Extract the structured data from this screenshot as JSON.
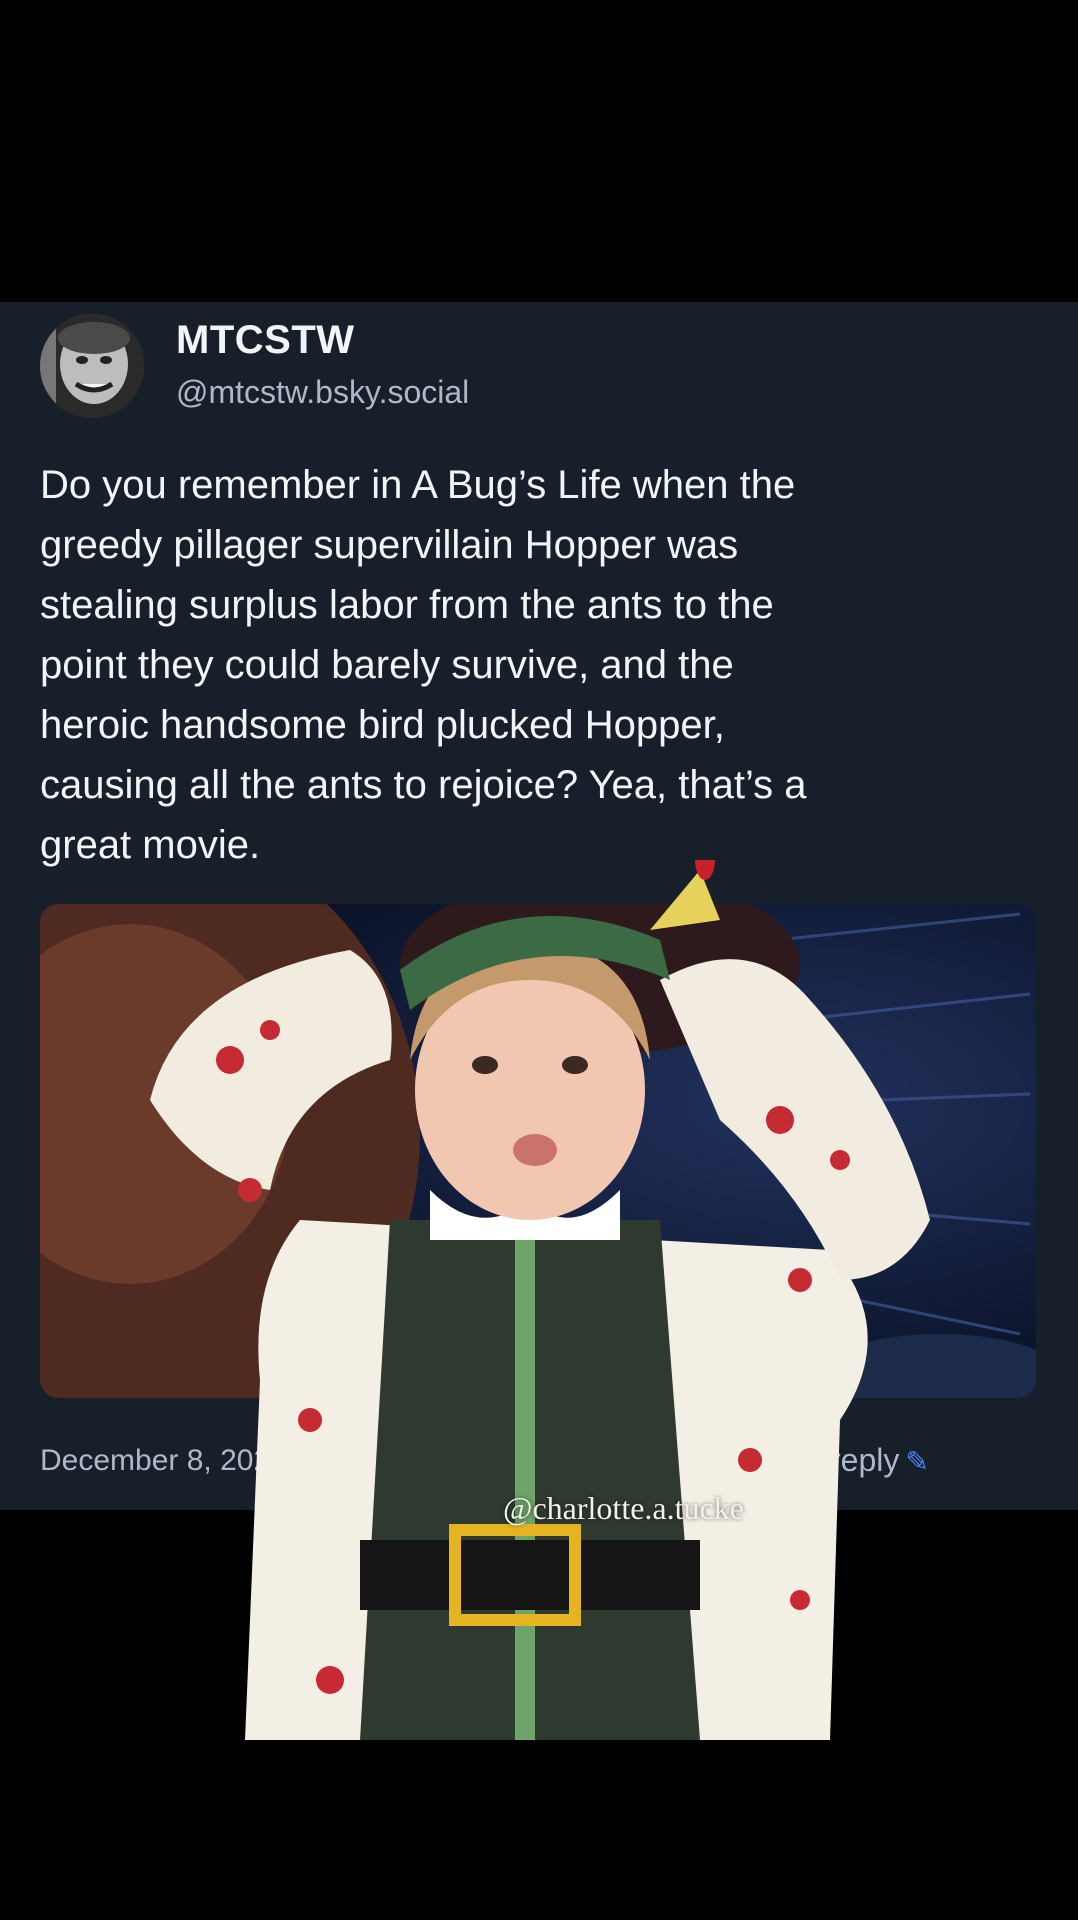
{
  "post": {
    "author": {
      "display_name": "MTCSTW",
      "handle": "@mtcstw.bsky.social"
    },
    "text_lines": [
      "Do you remember in A Bug’s Life when the",
      "greedy pillager supervillain Hopper was",
      "stealing surplus labor from the ants to the",
      "point they could barely survive, and the",
      "heroic handsome bird plucked Hopper,",
      "causing all the ants to rejoice? Yea, that’s a",
      "great movie."
    ],
    "date": "December 8, 202",
    "reply_label": "reply",
    "reply_icon": "pencil-icon"
  },
  "overlay": {
    "watermark": "@charlotte.a.tucke"
  },
  "colors": {
    "card_background": "#171f2a",
    "page_background": "#000000",
    "primary_text": "#f2f4f7",
    "secondary_text": "#aeb8c6",
    "accent": "#4a86ff"
  }
}
